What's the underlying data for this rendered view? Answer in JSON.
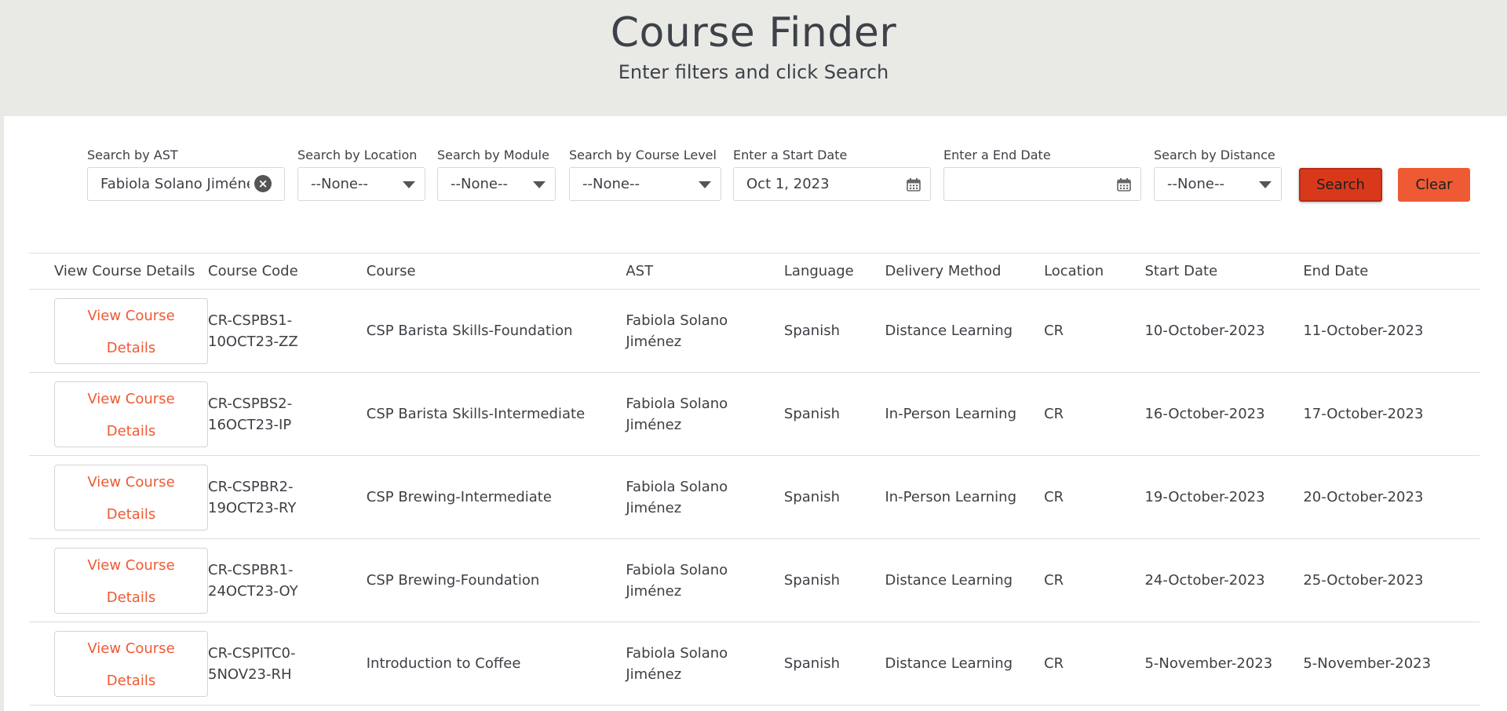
{
  "header": {
    "title": "Course Finder",
    "subtitle": "Enter filters and click Search"
  },
  "filters": {
    "ast": {
      "label": "Search by AST",
      "value": "Fabiola Solano Jiménez"
    },
    "location": {
      "label": "Search by Location",
      "value": "--None--"
    },
    "module": {
      "label": "Search by Module",
      "value": "--None--"
    },
    "level": {
      "label": "Search by Course Level",
      "value": "--None--"
    },
    "start_date": {
      "label": "Enter a Start Date",
      "value": "Oct 1, 2023"
    },
    "end_date": {
      "label": "Enter a End Date",
      "value": ""
    },
    "distance": {
      "label": "Search by Distance",
      "value": "--None--"
    },
    "search_label": "Search",
    "clear_label": "Clear"
  },
  "table": {
    "columns": [
      "View Course Details",
      "Course Code",
      "Course",
      "AST",
      "Language",
      "Delivery Method",
      "Location",
      "Start Date",
      "End Date"
    ],
    "view_line1": "View Course",
    "view_line2": "Details",
    "rows": [
      {
        "code1": "CR-CSPBS1-",
        "code2": "10OCT23-ZZ",
        "course": "CSP Barista Skills-Foundation",
        "ast1": "Fabiola Solano",
        "ast2": "Jiménez",
        "language": "Spanish",
        "delivery": "Distance Learning",
        "location": "CR",
        "start": "10-October-2023",
        "end": "11-October-2023"
      },
      {
        "code1": "CR-CSPBS2-",
        "code2": "16OCT23-IP",
        "course": "CSP Barista Skills-Intermediate",
        "ast1": "Fabiola Solano",
        "ast2": "Jiménez",
        "language": "Spanish",
        "delivery": "In-Person Learning",
        "location": "CR",
        "start": "16-October-2023",
        "end": "17-October-2023"
      },
      {
        "code1": "CR-CSPBR2-",
        "code2": "19OCT23-RY",
        "course": "CSP Brewing-Intermediate",
        "ast1": "Fabiola Solano",
        "ast2": "Jiménez",
        "language": "Spanish",
        "delivery": "In-Person Learning",
        "location": "CR",
        "start": "19-October-2023",
        "end": "20-October-2023"
      },
      {
        "code1": "CR-CSPBR1-",
        "code2": "24OCT23-OY",
        "course": "CSP Brewing-Foundation",
        "ast1": "Fabiola Solano",
        "ast2": "Jiménez",
        "language": "Spanish",
        "delivery": "Distance Learning",
        "location": "CR",
        "start": "24-October-2023",
        "end": "25-October-2023"
      },
      {
        "code1": "CR-CSPITC0-",
        "code2": "5NOV23-RH",
        "course": "Introduction to Coffee",
        "ast1": "Fabiola Solano",
        "ast2": "Jiménez",
        "language": "Spanish",
        "delivery": "Distance Learning",
        "location": "CR",
        "start": "5-November-2023",
        "end": "5-November-2023"
      }
    ]
  }
}
